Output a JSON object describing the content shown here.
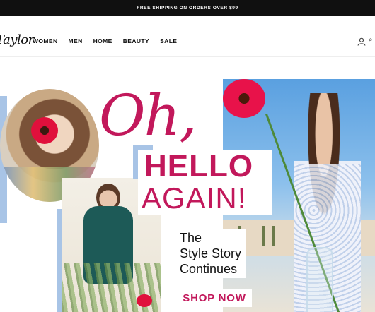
{
  "announcement": "FREE SHIPPING ON ORDERS OVER $99",
  "brand": {
    "logo_text": "Taylor"
  },
  "nav": {
    "items": [
      {
        "label": "WOMEN"
      },
      {
        "label": "MEN"
      },
      {
        "label": "HOME"
      },
      {
        "label": "BEAUTY"
      },
      {
        "label": "SALE"
      }
    ]
  },
  "header_icons": [
    "account-icon",
    "more-icon"
  ],
  "hero": {
    "script_text": "Oh,",
    "headline_1": "HELLO",
    "headline_2": "AGAIN!",
    "tagline_1": "The",
    "tagline_2": "Style Story",
    "tagline_3": "Continues",
    "cta": "SHOP NOW",
    "accent_color": "#c2185b",
    "frame_color": "#a8c4e6"
  }
}
